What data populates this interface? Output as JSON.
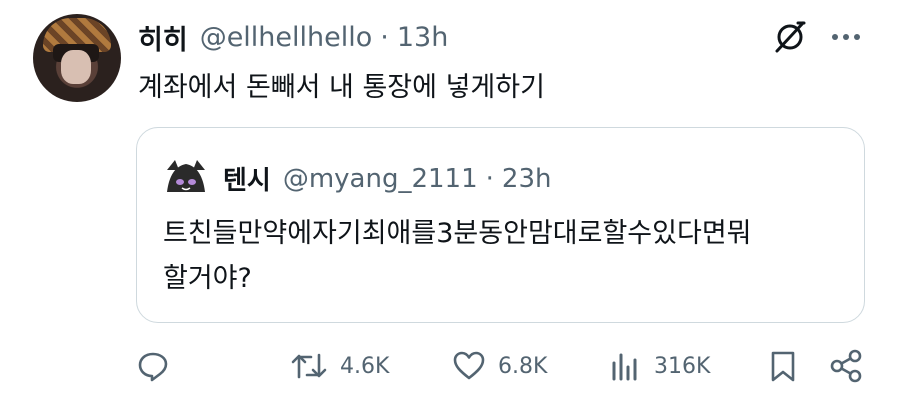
{
  "tweet": {
    "display_name": "히히",
    "handle": "@ellhellhello",
    "separator": "·",
    "time": "13h",
    "text": "계좌에서 돈빼서 내 통장에 넣게하기"
  },
  "quoted_tweet": {
    "display_name": "텐시",
    "handle": "@myang_2111",
    "separator": "·",
    "time": "23h",
    "text_line1": "트친들만약에자기최애를3분동안맘대로할수있다면뭐",
    "text_line2": "할거야?"
  },
  "actions": {
    "replies": "",
    "reposts": "4.6K",
    "likes": "6.8K",
    "views": "316K"
  },
  "icons": {
    "grok": "grok-icon",
    "more": "more-icon",
    "reply": "reply-icon",
    "repost": "repost-icon",
    "like": "heart-icon",
    "views": "views-icon",
    "bookmark": "bookmark-icon",
    "share": "share-icon"
  },
  "colors": {
    "text": "#0f1419",
    "secondary": "#536471",
    "border": "#cfd9de"
  }
}
